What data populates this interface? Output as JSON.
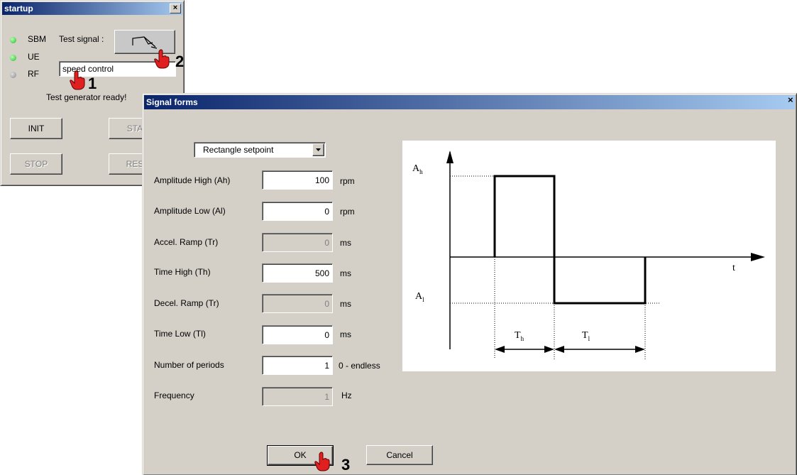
{
  "startup": {
    "title": "startup",
    "close": "×",
    "indicators": [
      {
        "label": "SBM",
        "color": "#33cc33"
      },
      {
        "label": "UE",
        "color": "#33cc33"
      },
      {
        "label": "RF",
        "color": "#8a8a8a"
      }
    ],
    "test_signal_label": "Test signal :",
    "mode_value": "speed control",
    "status_text": "Test generator ready!",
    "buttons": {
      "init": "INIT",
      "start": "STA",
      "stop": "STOP",
      "reset": "RES"
    }
  },
  "signal_forms": {
    "title": "Signal forms",
    "close": "×",
    "signal_type": "Rectangle setpoint",
    "fields": [
      {
        "label": "Amplitude High (Ah)",
        "value": "100",
        "unit": "rpm",
        "enabled": true
      },
      {
        "label": "Amplitude Low (Al)",
        "value": "0",
        "unit": "rpm",
        "enabled": true
      },
      {
        "label": "Accel. Ramp (Tr)",
        "value": "0",
        "unit": "ms",
        "enabled": false
      },
      {
        "label": "Time High (Th)",
        "value": "500",
        "unit": "ms",
        "enabled": true
      },
      {
        "label": "Decel. Ramp (Tr)",
        "value": "0",
        "unit": "ms",
        "enabled": false
      },
      {
        "label": "Time Low (Tl)",
        "value": "0",
        "unit": "ms",
        "enabled": true
      },
      {
        "label": "Number of periods",
        "value": "1",
        "unit": "0 - endless",
        "enabled": true
      },
      {
        "label": "Frequency",
        "value": "1",
        "unit": "Hz",
        "enabled": false
      }
    ],
    "ok_label": "OK",
    "cancel_label": "Cancel",
    "diagram": {
      "ah_label": "A",
      "ah_sub": "h",
      "al_label": "A",
      "al_sub": "l",
      "t_label": "t",
      "th_label": "T",
      "th_sub": "h",
      "tl_label": "T",
      "tl_sub": "l"
    }
  },
  "callouts": [
    "1",
    "2",
    "3"
  ],
  "colors": {
    "titlebar_start": "#0a246a",
    "titlebar_end": "#a6caf0",
    "window_bg": "#d4d0c8",
    "hand": "#e02020"
  }
}
